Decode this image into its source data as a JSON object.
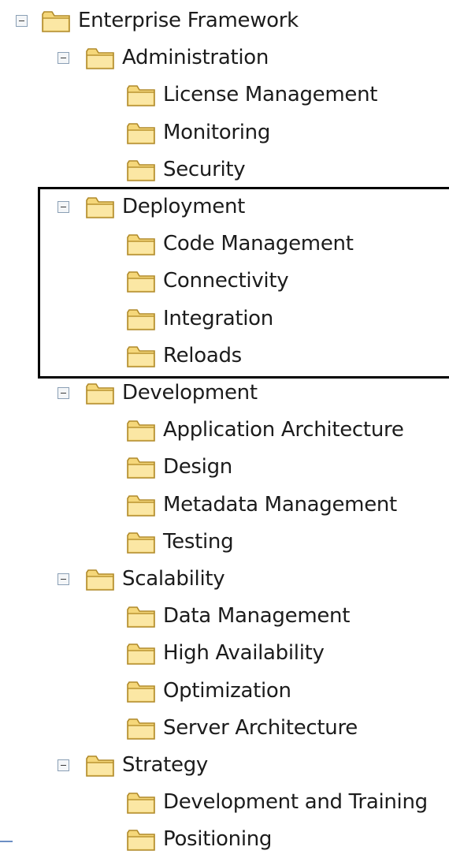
{
  "tree": {
    "items": [
      {
        "label": "Enterprise Framework",
        "level": 0,
        "expanded": true
      },
      {
        "label": "Administration",
        "level": 1,
        "expanded": true
      },
      {
        "label": "License Management",
        "level": 2
      },
      {
        "label": "Monitoring",
        "level": 2
      },
      {
        "label": "Security",
        "level": 2
      },
      {
        "label": "Deployment",
        "level": 1,
        "expanded": true
      },
      {
        "label": "Code Management",
        "level": 2
      },
      {
        "label": "Connectivity",
        "level": 2
      },
      {
        "label": "Integration",
        "level": 2
      },
      {
        "label": "Reloads",
        "level": 2
      },
      {
        "label": "Development",
        "level": 1,
        "expanded": true
      },
      {
        "label": "Application Architecture",
        "level": 2
      },
      {
        "label": "Design",
        "level": 2
      },
      {
        "label": "Metadata Management",
        "level": 2
      },
      {
        "label": "Testing",
        "level": 2
      },
      {
        "label": "Scalability",
        "level": 1,
        "expanded": true
      },
      {
        "label": "Data Management",
        "level": 2
      },
      {
        "label": "High Availability",
        "level": 2
      },
      {
        "label": "Optimization",
        "level": 2
      },
      {
        "label": "Server Architecture",
        "level": 2
      },
      {
        "label": "Strategy",
        "level": 1,
        "expanded": true
      },
      {
        "label": "Development and Training",
        "level": 2
      },
      {
        "label": "Positioning",
        "level": 2
      }
    ],
    "toggle_icon": "collapse-minus-icon",
    "folder_icon": "folder-icon"
  },
  "colors": {
    "folder_fill": "#f5d77a",
    "folder_stroke": "#b08a2a",
    "highlight_border": "#000000"
  }
}
